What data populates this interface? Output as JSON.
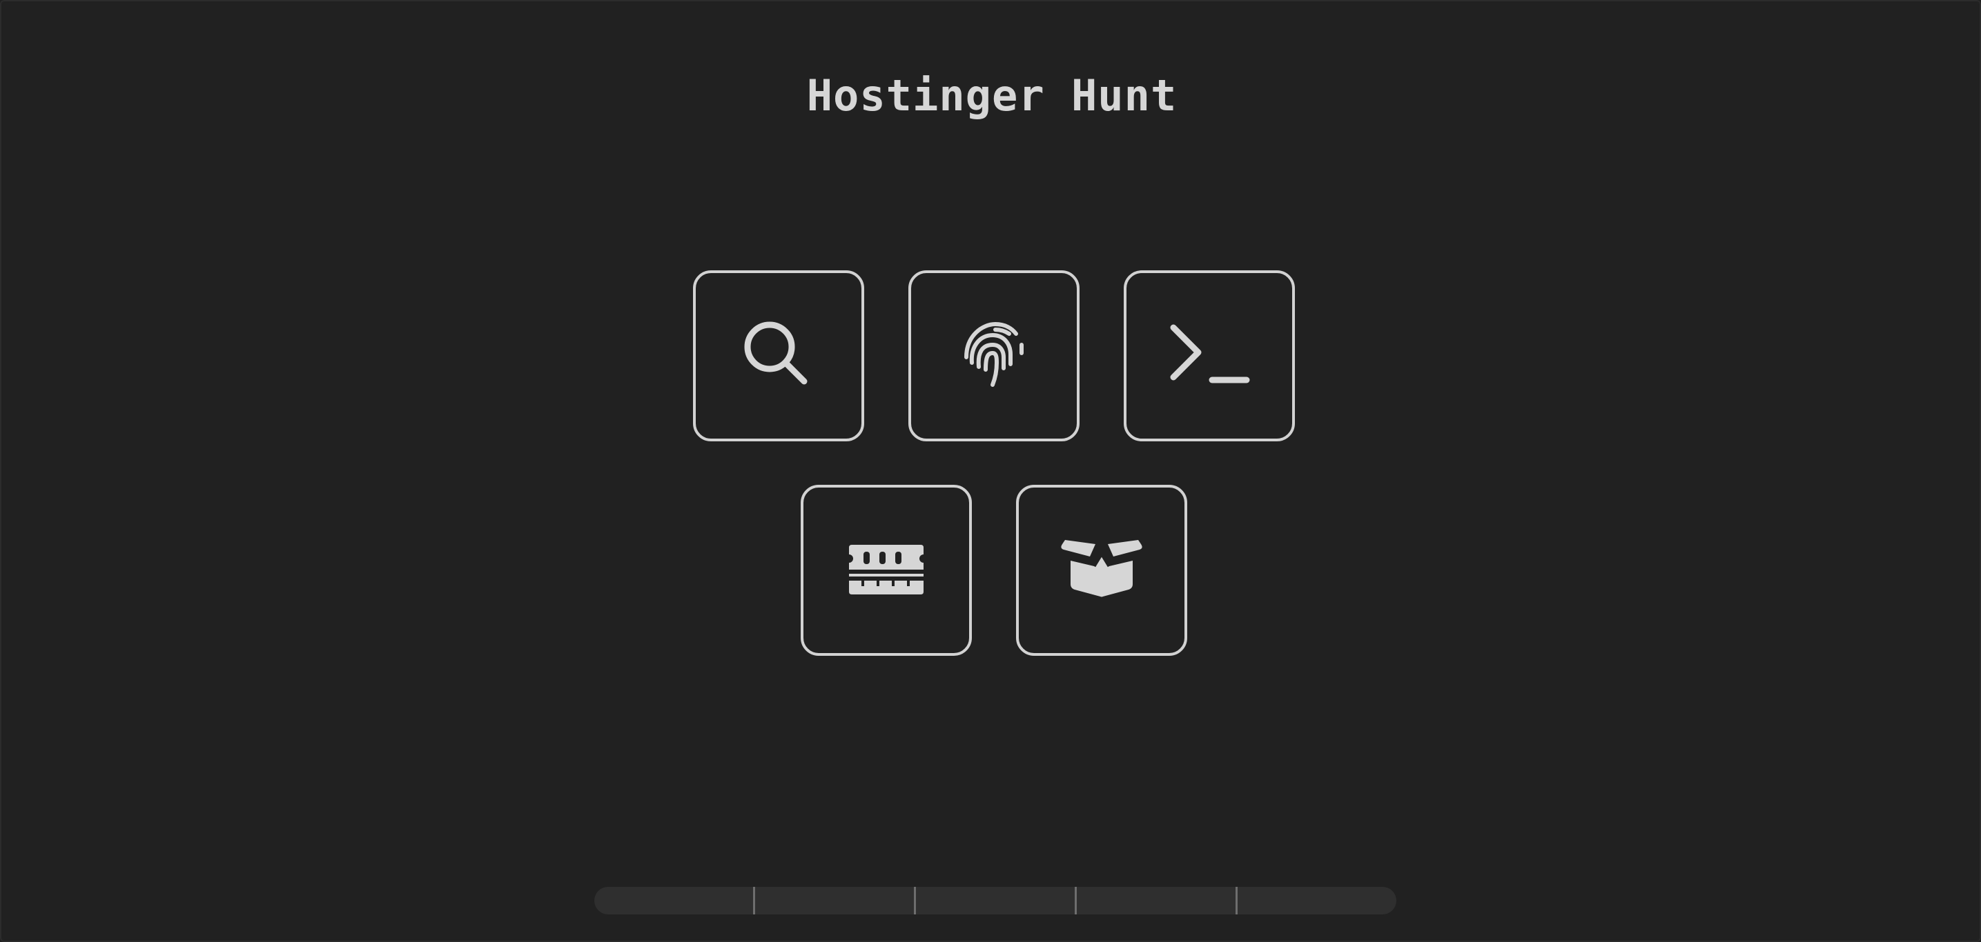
{
  "title": "Hostinger Hunt",
  "colors": {
    "background": "#212121",
    "tile_border": "#d2d2d2",
    "icon": "#d6d6d6",
    "progress_track": "#2f2f2f",
    "progress_divider": "#6e6e6e"
  },
  "tiles": [
    {
      "icon": "search-icon"
    },
    {
      "icon": "fingerprint-icon"
    },
    {
      "icon": "terminal-icon"
    },
    {
      "icon": "memory-ram-icon"
    },
    {
      "icon": "open-box-icon"
    }
  ],
  "progress": {
    "segments_total": 5,
    "segments_completed": 0
  }
}
